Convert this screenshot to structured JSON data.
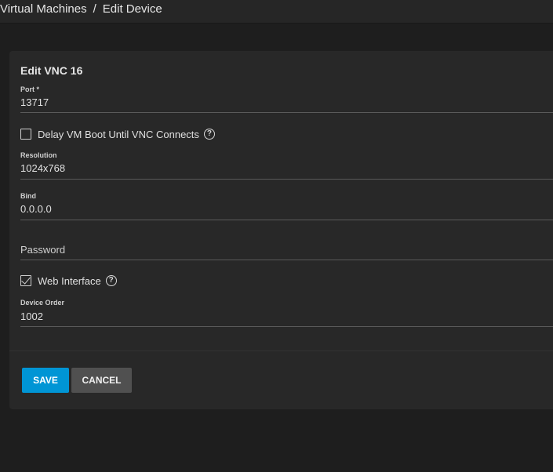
{
  "breadcrumb": {
    "parent": "Virtual Machines",
    "separator": "/",
    "current": "Edit Device"
  },
  "form": {
    "title": "Edit VNC 16",
    "port": {
      "label": "Port *",
      "value": "13717"
    },
    "delay_boot": {
      "label": "Delay VM Boot Until VNC Connects",
      "checked": false
    },
    "resolution": {
      "label": "Resolution",
      "value": "1024x768"
    },
    "bind": {
      "label": "Bind",
      "value": "0.0.0.0"
    },
    "password": {
      "placeholder": "Password",
      "value": ""
    },
    "web_interface": {
      "label": "Web Interface",
      "checked": true
    },
    "device_order": {
      "label": "Device Order",
      "value": "1002"
    },
    "help_glyph": "?"
  },
  "actions": {
    "save_label": "SAVE",
    "cancel_label": "CANCEL"
  },
  "colors": {
    "background": "#1e1e1e",
    "card": "#282828",
    "primary": "#0095d5",
    "secondary": "#505050"
  }
}
